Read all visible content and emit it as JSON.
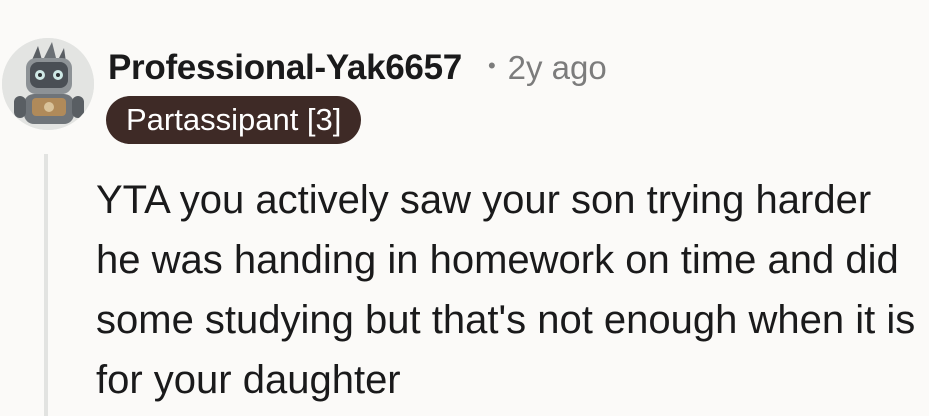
{
  "comment": {
    "author": "Professional-Yak6657",
    "separator": "•",
    "timestamp": "2y ago",
    "flair": "Partassipant [3]",
    "body": "YTA you actively saw your son trying harder he was handing in homework on time and did some studying but that's not enough when it is for your daughter",
    "avatar_icon": "robot-snoo-avatar-icon"
  }
}
